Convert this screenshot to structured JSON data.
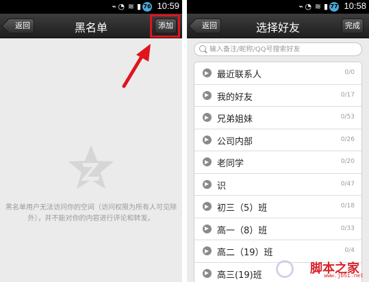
{
  "left_screen": {
    "status_time": "10:59",
    "battery_level": "76",
    "back_label": "返回",
    "title": "黑名单",
    "add_label": "添加",
    "empty_message": "黑名单用户无法访问你的空间（访问权限为所有人可见除外），并不能对你的内容进行评论和转发。",
    "colors": {
      "highlight": "#e0141c",
      "arrow": "#e0141c"
    }
  },
  "right_screen": {
    "status_time": "10:58",
    "battery_level": "77",
    "back_label": "返回",
    "title": "选择好友",
    "done_label": "完成",
    "search_placeholder": "输入备注/昵称/QQ号搜索好友",
    "groups": [
      {
        "name": "最近联系人",
        "count": "0/0"
      },
      {
        "name": "我的好友",
        "count": "0/17"
      },
      {
        "name": "兄弟姐妹",
        "count": "0/53"
      },
      {
        "name": "公司内部",
        "count": "0/26"
      },
      {
        "name": "老同学",
        "count": "0/20"
      },
      {
        "name": "识",
        "count": "0/47"
      },
      {
        "name": "初三（5）班",
        "count": "0/18"
      },
      {
        "name": "高一（8）班",
        "count": "0/33"
      },
      {
        "name": "高二（19）班",
        "count": "0/4"
      },
      {
        "name": "高三(19)班",
        "count": ""
      }
    ]
  },
  "watermark": {
    "text": "脚本之家",
    "url": "www.jb51.net"
  }
}
